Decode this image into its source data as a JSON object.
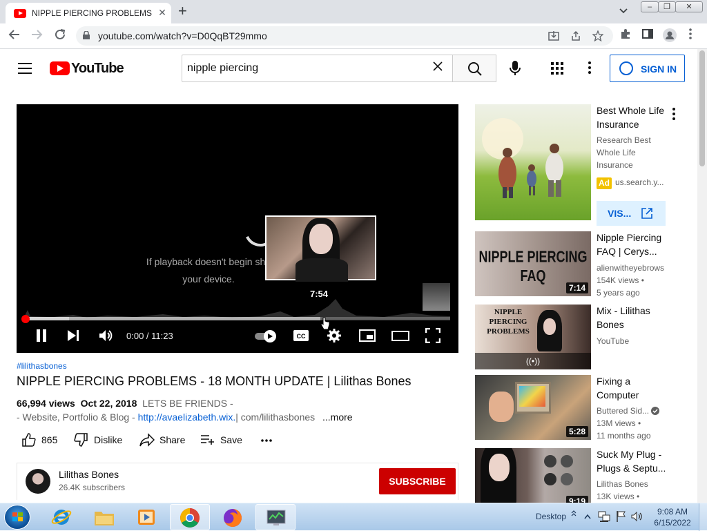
{
  "browser": {
    "tab_title": "NIPPLE PIERCING PROBLEMS - 1",
    "url": "youtube.com/watch?v=D0QqBT29mmo",
    "new_tab_symbol": "+",
    "tab_close_symbol": "✕"
  },
  "masthead": {
    "logo_text": "YouTube",
    "search_value": "nipple piercing",
    "sign_in_label": "SIGN IN"
  },
  "player": {
    "playback_message": "If playback doesn't begin shortly, try restarting your device.",
    "playback_message_visible_line1": "If playback doesn't begin sho",
    "playback_message_visible_line2": "your device.",
    "preview_time": "7:54",
    "time_readout": "0:00 / 11:23",
    "progress_played_fraction": 0.0,
    "hover_fraction": 0.694
  },
  "video": {
    "hashtag": "#lilithasbones",
    "title": "NIPPLE PIERCING PROBLEMS - 18 MONTH UPDATE | Lilithas Bones",
    "views": "66,994 views",
    "date": "Oct 22, 2018",
    "desc_lead": "LETS BE FRIENDS -",
    "desc_line2_prefix": "- Website, Portfolio & Blog - ",
    "desc_link": "http://avaelizabeth.wix.",
    "desc_line2_suffix": "| com/lilithasbones",
    "more_label": "...more"
  },
  "actions": {
    "like_count": "865",
    "dislike_label": "Dislike",
    "share_label": "Share",
    "save_label": "Save"
  },
  "channel": {
    "name": "Lilithas Bones",
    "subscribers": "26.4K subscribers",
    "subscribe_label": "SUBSCRIBE"
  },
  "sidebar": {
    "ad": {
      "title": "Best Whole Life Insurance",
      "advertiser": "Research Best Whole Life Insurance",
      "badge": "Ad",
      "domain": "us.search.y...",
      "visit_label": "VIS..."
    },
    "items": [
      {
        "title": "Nipple Piercing FAQ | Cerys...",
        "channel": "alienwitheyebrows",
        "views": "154K views •",
        "age": "5 years ago",
        "duration": "7:14",
        "thumb_text": "NIPPLE PIERCING FAQ"
      },
      {
        "title": "Mix - Lilithas Bones",
        "channel": "YouTube",
        "thumb_text": "NIPPLE PIERCING PROBLEMS",
        "mix_icon": "((•))"
      },
      {
        "title": "Fixing a Computer",
        "channel": "Buttered Sid...",
        "views": "13M views •",
        "age": "11 months ago",
        "duration": "5:28"
      },
      {
        "title": "Suck My Plug - Plugs & Septu...",
        "channel": "Lilithas Bones",
        "views": "13K views •",
        "duration": "9:19"
      }
    ]
  },
  "taskbar": {
    "desktop_label": "Desktop",
    "time": "9:08 AM",
    "date": "6/15/2022"
  }
}
